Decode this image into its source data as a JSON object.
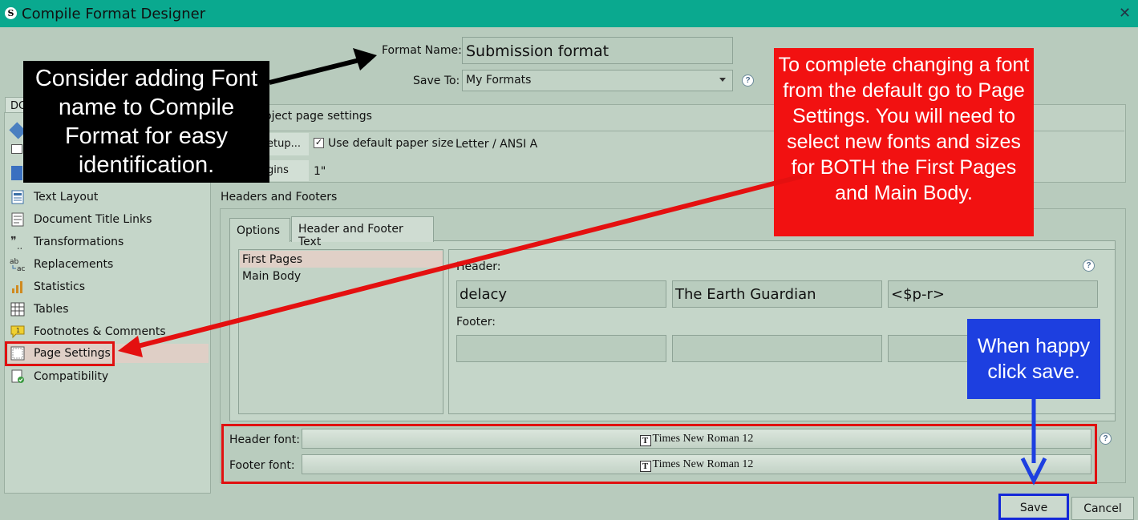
{
  "window": {
    "title": "Compile Format Designer",
    "app_icon_letter": "S",
    "close_glyph": "✕"
  },
  "form": {
    "format_name_label": "Format Name:",
    "format_name_value": "Submission format",
    "save_to_label": "Save To:",
    "save_to_value": "My Formats",
    "help_glyph": "?"
  },
  "sidebar": {
    "tab_label": "DC",
    "items": [
      {
        "label": "Text Layout",
        "icon": "text-layout-icon"
      },
      {
        "label": "Document Title Links",
        "icon": "document-title-links-icon"
      },
      {
        "label": "Transformations",
        "icon": "transformations-icon"
      },
      {
        "label": "Replacements",
        "icon": "replacements-icon"
      },
      {
        "label": "Statistics",
        "icon": "statistics-icon"
      },
      {
        "label": "Tables",
        "icon": "tables-icon"
      },
      {
        "label": "Footnotes & Comments",
        "icon": "footnotes-comments-icon"
      },
      {
        "label": "Page Settings",
        "icon": "page-settings-icon",
        "selected": true
      },
      {
        "label": "Compatibility",
        "icon": "compatibility-icon"
      }
    ]
  },
  "project_page": {
    "title": "oject page settings",
    "setup_label": "etup...",
    "use_default_label": "Use default paper size",
    "use_default_checked": true,
    "paper_size": "Letter / ANSI A",
    "margins_label": "gins",
    "margins_value": "1\""
  },
  "headers_footers": {
    "section_title": "Headers and Footers",
    "tabs": [
      "Options",
      "Header and Footer Text"
    ],
    "active_tab": "Header and Footer Text",
    "pages": [
      "First Pages",
      "Main Body"
    ],
    "selected_page": "First Pages",
    "header_label": "Header:",
    "footer_label": "Footer:",
    "header_fields": [
      "delacy",
      "The Earth Guardian",
      "<$p-r>"
    ],
    "footer_fields": [
      "",
      "",
      ""
    ]
  },
  "fonts": {
    "header_font_label": "Header font:",
    "header_font_value": "Times New Roman 12",
    "footer_font_label": "Footer font:",
    "footer_font_value": "Times New Roman 12",
    "font_icon_glyph": "T"
  },
  "buttons": {
    "save": "Save",
    "cancel": "Cancel"
  },
  "annotations": {
    "black_callout": "Consider adding Font name to Compile Format for easy identification.",
    "red_callout": "To complete changing a font from the default go to Page Settings. You will need to select new fonts and sizes for BOTH the First Pages and Main Body.",
    "blue_callout": "When happy click save.",
    "colors": {
      "black": "#000000",
      "red": "#f21111",
      "blue": "#1d3fe0",
      "title_bar": "#0aa98f"
    }
  }
}
